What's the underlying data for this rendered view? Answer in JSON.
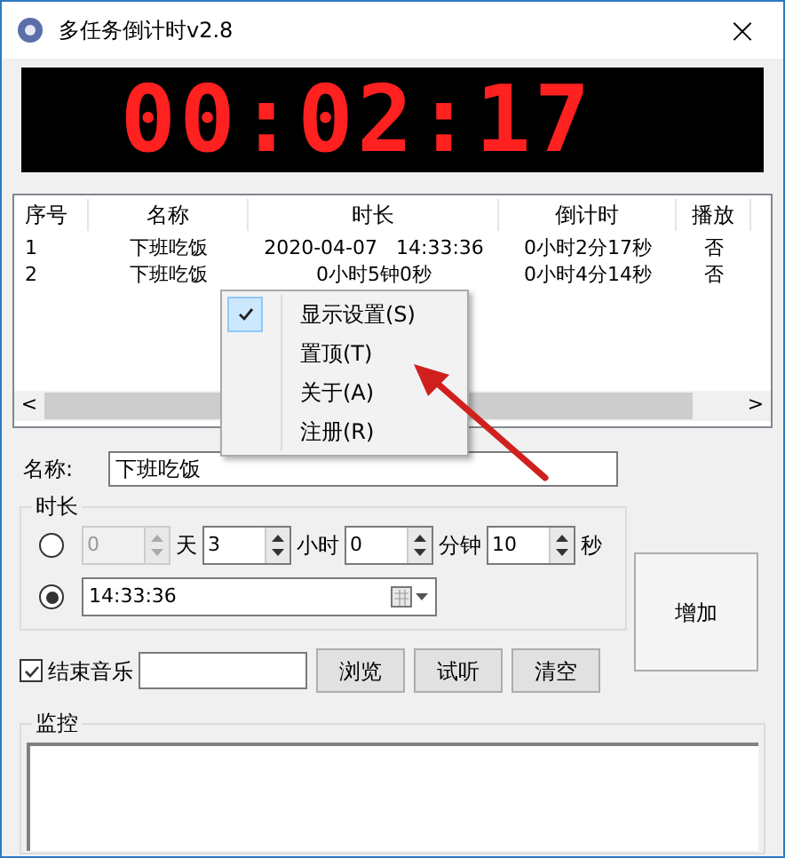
{
  "window": {
    "title": "多任务倒计时v2.8",
    "close": "×"
  },
  "clock": {
    "time": "00:02:17"
  },
  "table": {
    "columns": [
      "序号",
      "名称",
      "时长",
      "倒计时",
      "播放"
    ],
    "rows": [
      [
        "1",
        "下班吃饭",
        "2020-04-07   14:33:36",
        "0小时2分17秒",
        "否"
      ],
      [
        "2",
        "下班吃饭",
        "0小时5钟0秒",
        "0小时4分14秒",
        "否"
      ]
    ],
    "scroll_left": "<",
    "scroll_right": ">"
  },
  "context_menu": {
    "items": [
      {
        "label": "显示设置(S)",
        "checked": true
      },
      {
        "label": "置顶(T)",
        "checked": false
      },
      {
        "label": "关于(A)",
        "checked": false
      },
      {
        "label": "注册(R)",
        "checked": false
      }
    ]
  },
  "name_field": {
    "label": "名称:",
    "value": "下班吃饭"
  },
  "duration": {
    "title": "时长",
    "modes": [
      {
        "selected": false,
        "fields": [
          {
            "value": "0",
            "unit": "天",
            "disabled": true
          },
          {
            "value": "3",
            "unit": "小时",
            "disabled": false
          },
          {
            "value": "0",
            "unit": "分钟",
            "disabled": false
          },
          {
            "value": "10",
            "unit": "秒",
            "disabled": false
          }
        ]
      },
      {
        "selected": true,
        "value": "14:33:36"
      }
    ]
  },
  "music": {
    "label": "结束音乐",
    "checked": true,
    "buttons": [
      "浏览",
      "试听",
      "清空"
    ]
  },
  "add_button": "增加",
  "monitor": {
    "title": "监控"
  }
}
